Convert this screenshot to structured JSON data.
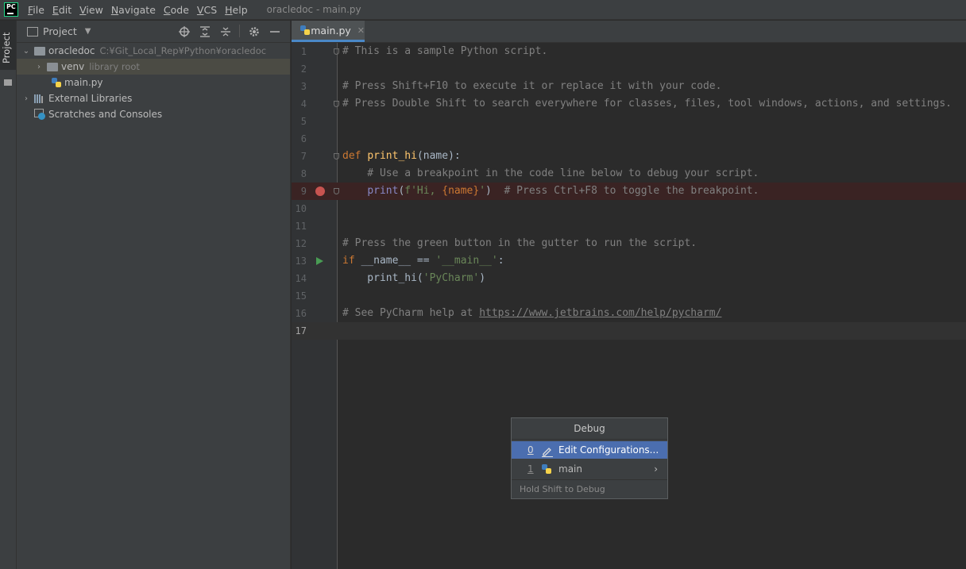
{
  "app": {
    "logo_text": "PC",
    "window_title": "oracledoc - main.py"
  },
  "menu": [
    {
      "label": "File"
    },
    {
      "label": "Edit"
    },
    {
      "label": "View"
    },
    {
      "label": "Navigate"
    },
    {
      "label": "Code"
    },
    {
      "label": "VCS"
    },
    {
      "label": "Help"
    }
  ],
  "toolstrip": {
    "project_tab": "Project"
  },
  "project_panel": {
    "title": "Project",
    "tree": {
      "root_name": "oracledoc",
      "root_path": "C:¥Git_Local_Rep¥Python¥oracledoc",
      "venv_name": "venv",
      "venv_note": "library root",
      "main_file": "main.py",
      "external_libraries": "External Libraries",
      "scratches": "Scratches and Consoles"
    }
  },
  "editor": {
    "tab_label": "main.py",
    "lines": {
      "l1": "# This is a sample Python script.",
      "l3": "# Press Shift+F10 to execute it or replace it with your code.",
      "l4": "# Press Double Shift to search everywhere for classes, files, tool windows, actions, and settings.",
      "l7_kw": "def",
      "l7_fn": "print_hi",
      "l7_rest": "(name):",
      "l8": "    # Use a breakpoint in the code line below to debug your script.",
      "l9_indent": "    ",
      "l9_builtin": "print",
      "l9_open": "(",
      "l9_str1": "f'Hi, ",
      "l9_expr": "{name}",
      "l9_str2": "'",
      "l9_close": ")  ",
      "l9_comment": "# Press Ctrl+F8 to toggle the breakpoint.",
      "l12": "# Press the green button in the gutter to run the script.",
      "l13_kw": "if",
      "l13_mid": " __name__ == ",
      "l13_str": "'__main__'",
      "l13_end": ":",
      "l14_pre": "    print_hi(",
      "l14_str": "'PyCharm'",
      "l14_end": ")",
      "l16_pre": "# See PyCharm help at ",
      "l16_link": "https://www.jetbrains.com/help/pycharm/"
    },
    "line_numbers": [
      "1",
      "2",
      "3",
      "4",
      "5",
      "6",
      "7",
      "8",
      "9",
      "10",
      "11",
      "12",
      "13",
      "14",
      "15",
      "16",
      "17"
    ]
  },
  "debug_popup": {
    "title": "Debug",
    "items": [
      {
        "num": "0",
        "label": "Edit Configurations..."
      },
      {
        "num": "1",
        "label": "main"
      }
    ],
    "hint": "Hold Shift to Debug"
  }
}
